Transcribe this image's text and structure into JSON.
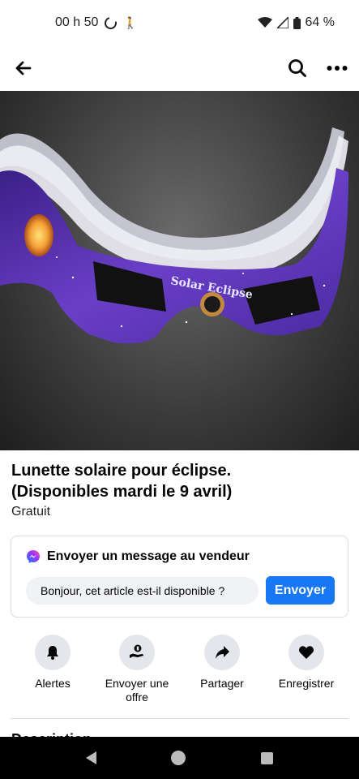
{
  "status_bar": {
    "time": "00 h 50",
    "battery": "64 %"
  },
  "listing": {
    "title_line1": "Lunette solaire pour éclipse.",
    "title_line2": "(Disponibles mardi le 9 avril)",
    "price": "Gratuit",
    "image_text": "Solar Eclipse"
  },
  "message": {
    "heading": "Envoyer un message au vendeur",
    "input_value": "Bonjour, cet article est-il disponible ?",
    "send_label": "Envoyer"
  },
  "actions": [
    {
      "label": "Alertes",
      "icon": "bell-icon"
    },
    {
      "label": "Envoyer une offre",
      "icon": "offer-icon"
    },
    {
      "label": "Partager",
      "icon": "share-icon"
    },
    {
      "label": "Enregistrer",
      "icon": "heart-icon"
    }
  ],
  "description_heading": "Description",
  "colors": {
    "accent": "#1877f2",
    "icon_bg": "#e4e6eb"
  }
}
